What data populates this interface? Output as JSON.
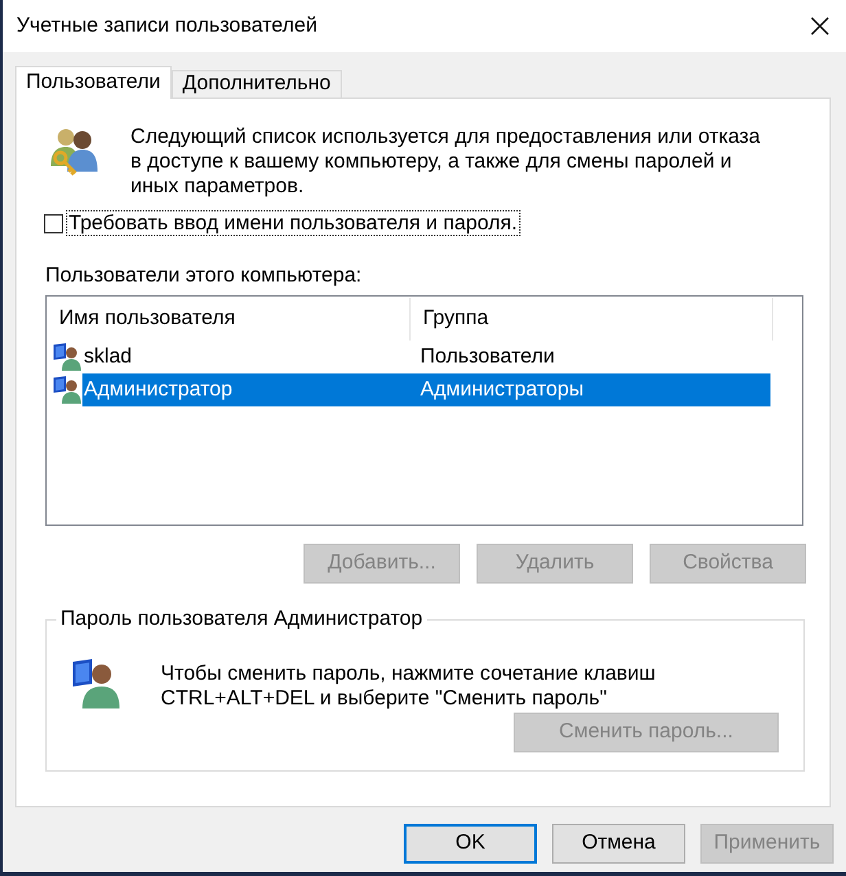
{
  "window": {
    "title": "Учетные записи пользователей"
  },
  "tabs": [
    {
      "label": "Пользователи",
      "selected": true
    },
    {
      "label": "Дополнительно",
      "selected": false
    }
  ],
  "intro": {
    "text": "Следующий список используется для предоставления или отказа в доступе к вашему компьютеру, а также для смены паролей и иных параметров."
  },
  "require_login": {
    "label": "Требовать ввод имени пользователя и пароля.",
    "checked": false,
    "focused": true
  },
  "users": {
    "label": "Пользователи этого компьютера:",
    "columns": [
      "Имя пользователя",
      "Группа"
    ],
    "rows": [
      {
        "name": "sklad",
        "group": "Пользователи",
        "selected": false
      },
      {
        "name": "Администратор",
        "group": "Администраторы",
        "selected": true
      }
    ]
  },
  "user_buttons": [
    {
      "label": "Добавить...",
      "disabled": true
    },
    {
      "label": "Удалить",
      "disabled": true
    },
    {
      "label": "Свойства",
      "disabled": true
    }
  ],
  "password": {
    "title": "Пароль пользователя Администратор",
    "text": "Чтобы сменить пароль, нажмите сочетание клавиш CTRL+ALT+DEL и выберите \"Сменить пароль\"",
    "button": {
      "label": "Сменить пароль...",
      "disabled": true
    }
  },
  "dialog_buttons": [
    {
      "label": "OK",
      "default": true,
      "disabled": false
    },
    {
      "label": "Отмена",
      "default": false,
      "disabled": false
    },
    {
      "label": "Применить",
      "default": false,
      "disabled": true
    }
  ]
}
